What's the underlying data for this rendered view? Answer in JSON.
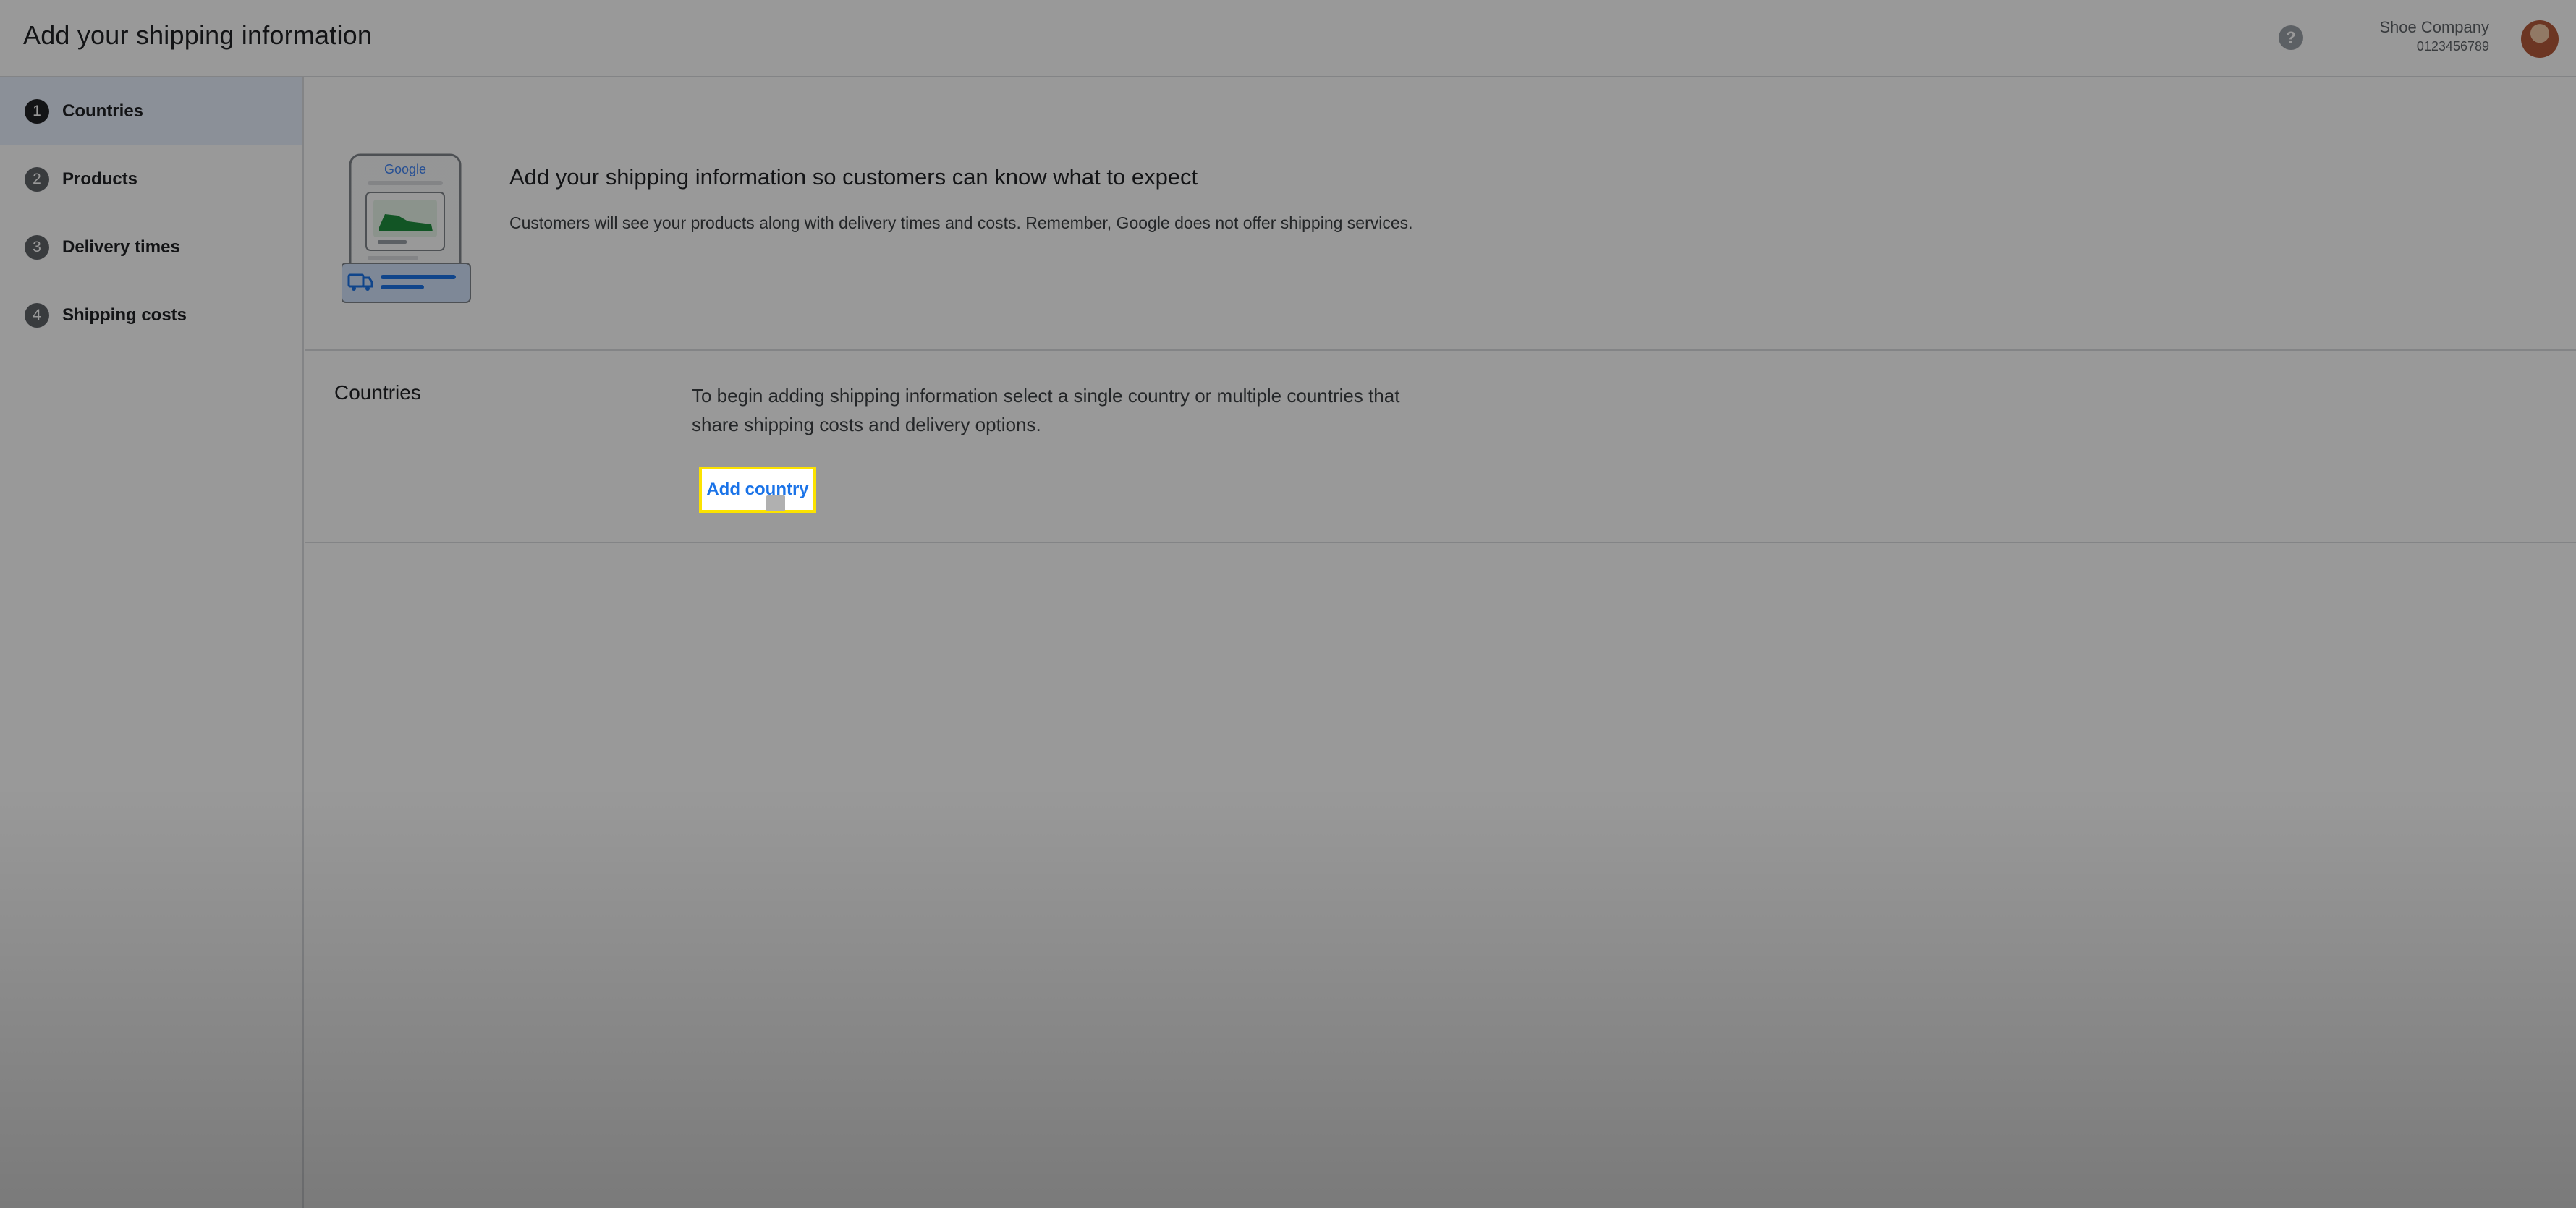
{
  "header": {
    "title": "Add your shipping information",
    "account_name": "Shoe Company",
    "account_id": "0123456789"
  },
  "sidebar": {
    "steps": [
      {
        "number": "1",
        "label": "Countries",
        "active": true
      },
      {
        "number": "2",
        "label": "Products",
        "active": false
      },
      {
        "number": "3",
        "label": "Delivery times",
        "active": false
      },
      {
        "number": "4",
        "label": "Shipping costs",
        "active": false
      }
    ]
  },
  "intro": {
    "logo_text": "Google",
    "heading": "Add your shipping information so customers can know what to expect",
    "description": "Customers will see your products along with delivery times and costs. Remember, Google does not offer shipping services."
  },
  "countries": {
    "title": "Countries",
    "description": "To begin adding shipping information select a single country or multiple countries that share shipping costs and delivery options.",
    "add_button_label": "Add country"
  },
  "colors": {
    "highlight": "#fce300",
    "link_blue": "#1a73e8",
    "active_step_bg": "#e8f0fe"
  },
  "icons": {
    "help": "help-circle-icon",
    "truck": "delivery-truck-icon"
  }
}
